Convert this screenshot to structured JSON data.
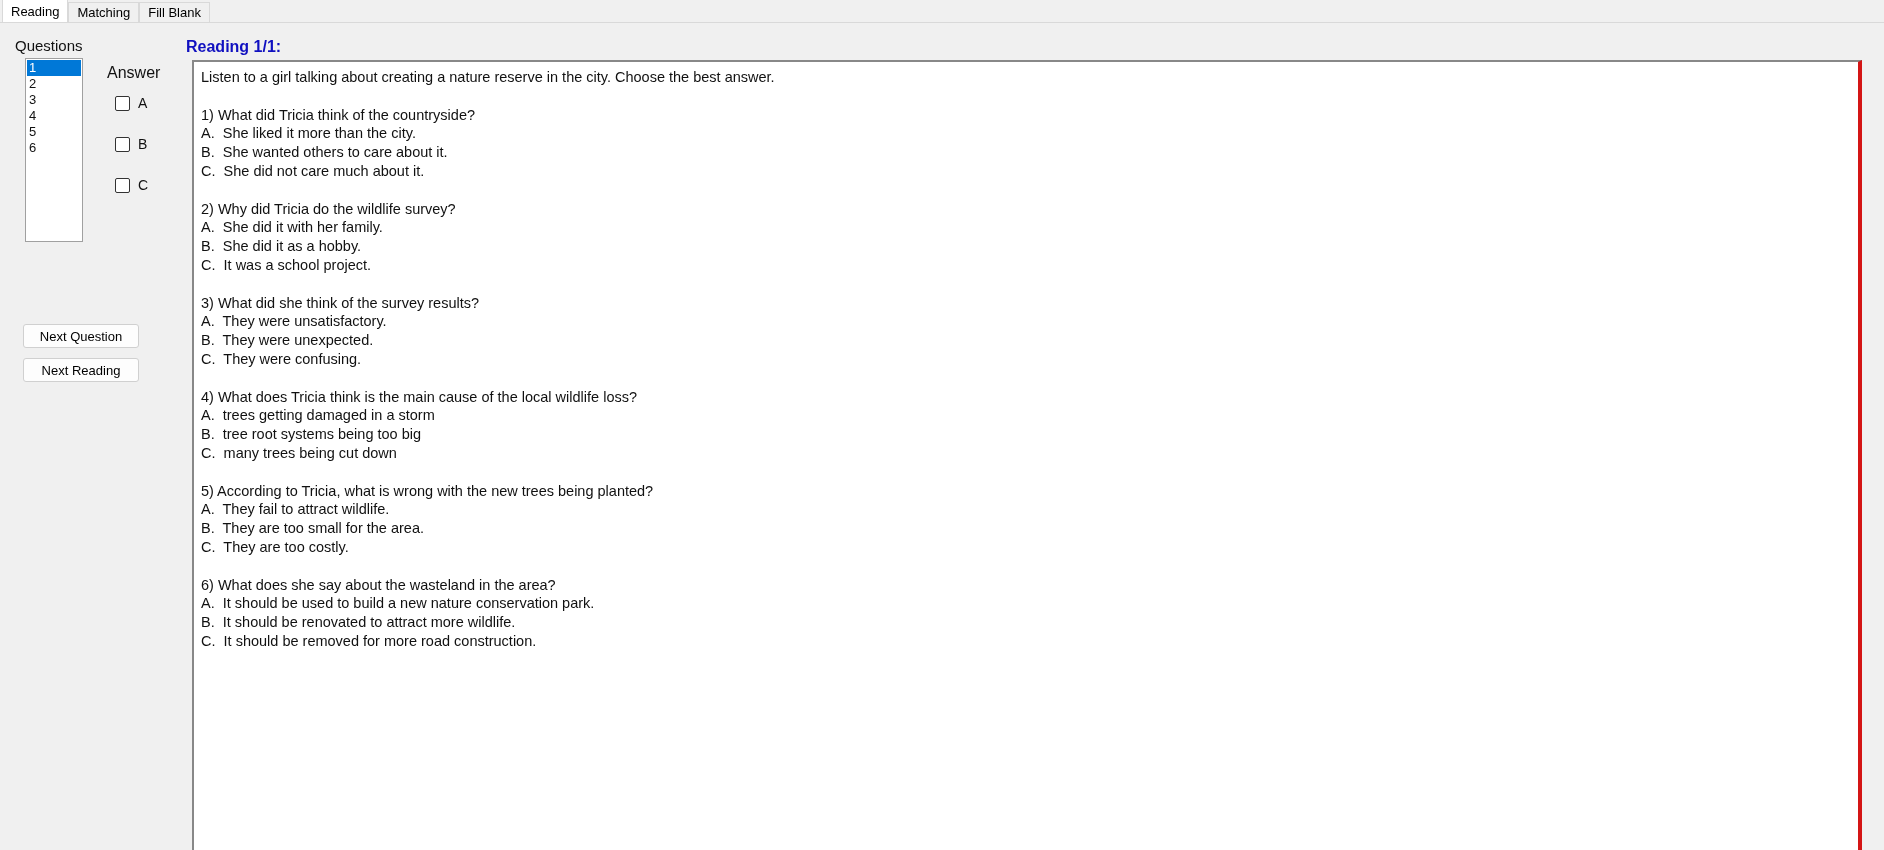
{
  "tabs": [
    {
      "label": "Reading",
      "selected": true
    },
    {
      "label": "Matching",
      "selected": false
    },
    {
      "label": "Fill Blank",
      "selected": false
    }
  ],
  "questions_panel": {
    "title": "Questions",
    "items": [
      {
        "label": "1",
        "selected": true
      },
      {
        "label": "2",
        "selected": false
      },
      {
        "label": "3",
        "selected": false
      },
      {
        "label": "4",
        "selected": false
      },
      {
        "label": "5",
        "selected": false
      },
      {
        "label": "6",
        "selected": false
      }
    ]
  },
  "answer": {
    "title": "Answer",
    "options": [
      {
        "label": "A",
        "checked": false
      },
      {
        "label": "B",
        "checked": false
      },
      {
        "label": "C",
        "checked": false
      }
    ]
  },
  "buttons": [
    "Next Question",
    "Next Reading"
  ],
  "reading": {
    "title": "Reading 1/1:",
    "intro": "Listen to a girl talking about creating a nature reserve in the city. Choose the best answer.",
    "questions": [
      {
        "question": "1) What did Tricia think of the countryside?",
        "options": [
          "A.  She liked it more than the city.",
          "B.  She wanted others to care about it.",
          "C.  She did not care much about it."
        ]
      },
      {
        "question": "2) Why did Tricia do the wildlife survey?",
        "options": [
          "A.  She did it with her family.",
          "B.  She did it as a hobby.",
          "C.  It was a school project."
        ]
      },
      {
        "question": "3) What did she think of the survey results?",
        "options": [
          "A.  They were unsatisfactory.",
          "B.  They were unexpected.",
          "C.  They were confusing."
        ]
      },
      {
        "question": "4) What does Tricia think is the main cause of the local wildlife loss?",
        "options": [
          "A.  trees getting damaged in a storm",
          "B.  tree root systems being too big",
          "C.  many trees being cut down"
        ]
      },
      {
        "question": "5) According to Tricia, what is wrong with the new trees being planted?",
        "options": [
          "A.  They fail to attract wildlife.",
          "B.  They are too small for the area.",
          "C.  They are too costly."
        ]
      },
      {
        "question": "6) What does she say about the wasteland in the area?",
        "options": [
          "A.  It should be used to build a new nature conservation park.",
          "B.  It should be renovated to attract more wildlife.",
          "C.  It should be removed for more road construction."
        ]
      }
    ]
  }
}
